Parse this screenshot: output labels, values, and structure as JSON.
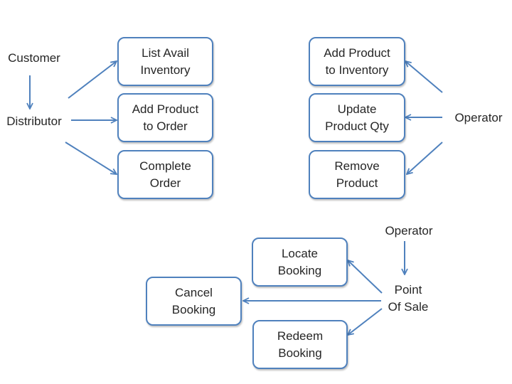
{
  "diagram": {
    "style": {
      "stroke_color": "#4f81bd",
      "text_color": "#262626",
      "background": "#ffffff"
    },
    "groups": [
      {
        "id": "distributor-group",
        "actors": [
          {
            "id": "customer",
            "label": "Customer"
          },
          {
            "id": "distributor",
            "label": "Distributor"
          }
        ],
        "use_cases": [
          {
            "id": "list-avail-inventory",
            "label": "List Avail\nInventory"
          },
          {
            "id": "add-product-to-order",
            "label": "Add Product\nto Order"
          },
          {
            "id": "complete-order",
            "label": "Complete\nOrder"
          }
        ],
        "edges": [
          {
            "from": "customer",
            "to": "distributor"
          },
          {
            "from": "distributor",
            "to": "list-avail-inventory"
          },
          {
            "from": "distributor",
            "to": "add-product-to-order"
          },
          {
            "from": "distributor",
            "to": "complete-order"
          }
        ]
      },
      {
        "id": "operator-inventory-group",
        "actors": [
          {
            "id": "operator-1",
            "label": "Operator"
          }
        ],
        "use_cases": [
          {
            "id": "add-product-to-inventory",
            "label": "Add Product\nto Inventory"
          },
          {
            "id": "update-product-qty",
            "label": "Update\nProduct Qty"
          },
          {
            "id": "remove-product",
            "label": "Remove\nProduct"
          }
        ],
        "edges": [
          {
            "from": "operator-1",
            "to": "add-product-to-inventory"
          },
          {
            "from": "operator-1",
            "to": "update-product-qty"
          },
          {
            "from": "operator-1",
            "to": "remove-product"
          }
        ]
      },
      {
        "id": "point-of-sale-group",
        "actors": [
          {
            "id": "operator-2",
            "label": "Operator"
          },
          {
            "id": "point-of-sale",
            "label": "Point\nOf Sale"
          }
        ],
        "use_cases": [
          {
            "id": "locate-booking",
            "label": "Locate\nBooking"
          },
          {
            "id": "cancel-booking",
            "label": "Cancel\nBooking"
          },
          {
            "id": "redeem-booking",
            "label": "Redeem\nBooking"
          }
        ],
        "edges": [
          {
            "from": "operator-2",
            "to": "point-of-sale"
          },
          {
            "from": "point-of-sale",
            "to": "locate-booking"
          },
          {
            "from": "point-of-sale",
            "to": "cancel-booking"
          },
          {
            "from": "point-of-sale",
            "to": "redeem-booking"
          }
        ]
      }
    ]
  }
}
